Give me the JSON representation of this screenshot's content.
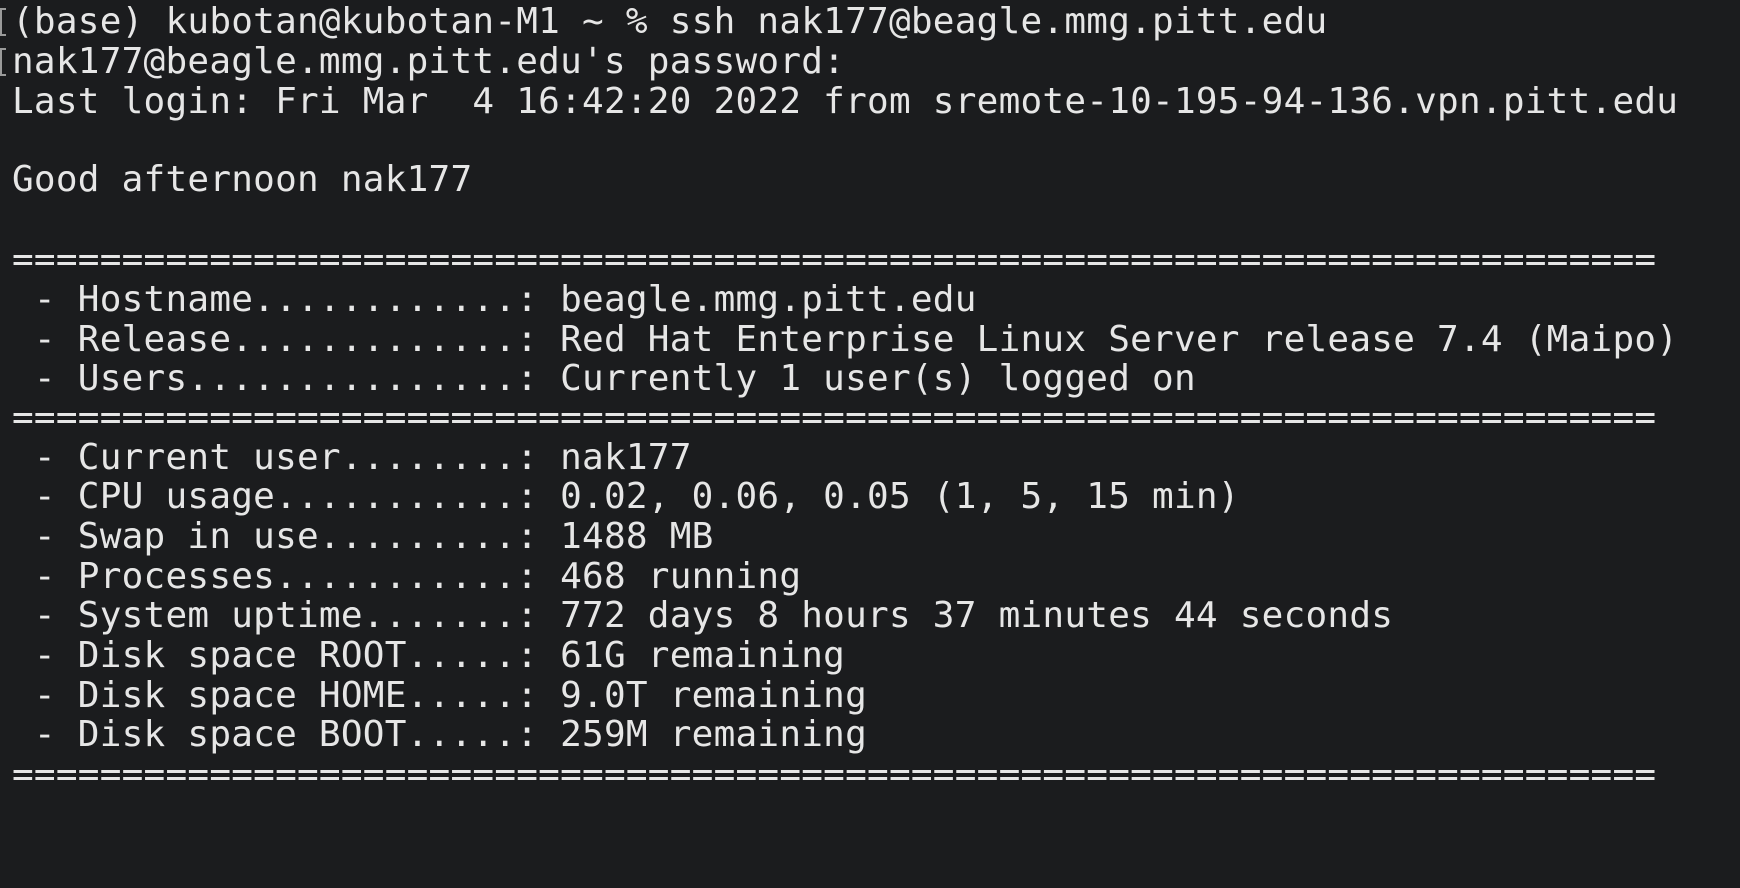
{
  "terminal": {
    "lines": [
      "(base) kubotan@kubotan-M1 ~ % ssh nak177@beagle.mmg.pitt.edu",
      "nak177@beagle.mmg.pitt.edu's password:",
      "Last login: Fri Mar  4 16:42:20 2022 from sremote-10-195-94-136.vpn.pitt.edu",
      "",
      "Good afternoon nak177",
      "",
      "===========================================================================",
      " - Hostname............: beagle.mmg.pitt.edu",
      " - Release.............: Red Hat Enterprise Linux Server release 7.4 (Maipo)",
      " - Users...............: Currently 1 user(s) logged on",
      "===========================================================================",
      " - Current user........: nak177",
      " - CPU usage...........: 0.02, 0.06, 0.05 (1, 5, 15 min)",
      " - Swap in use.........: 1488 MB",
      " - Processes...........: 468 running",
      " - System uptime.......: 772 days 8 hours 37 minutes 44 seconds",
      " - Disk space ROOT.....: 61G remaining",
      " - Disk space HOME.....: 9.0T remaining",
      " - Disk space BOOT.....: 259M remaining",
      "==========================================================================="
    ]
  },
  "colors": {
    "background": "#1b1c1e",
    "foreground": "#e6e6e6"
  }
}
